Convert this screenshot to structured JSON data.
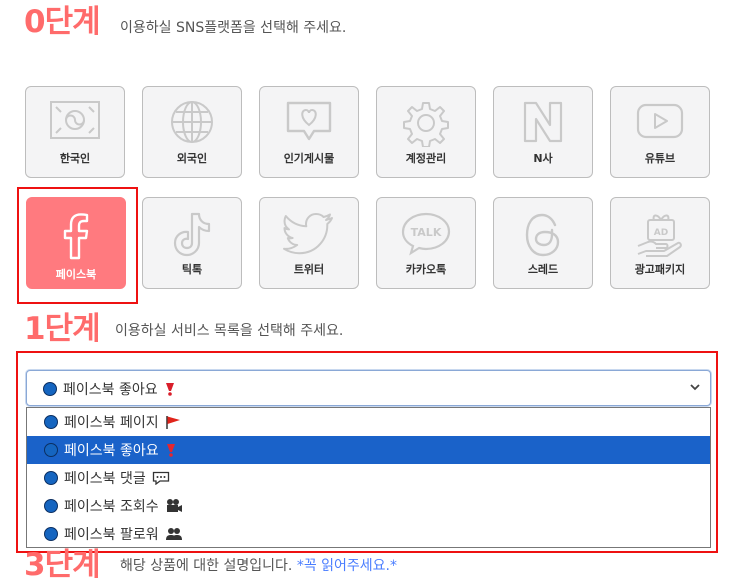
{
  "step0": {
    "title": "0단계",
    "desc": "이용하실 SNS플랫폼을 선택해 주세요."
  },
  "platforms": [
    {
      "label": "한국인",
      "icon": "korean-flag-icon"
    },
    {
      "label": "외국인",
      "icon": "globe-icon"
    },
    {
      "label": "인기게시물",
      "icon": "heart-speech-icon"
    },
    {
      "label": "계정관리",
      "icon": "gear-icon"
    },
    {
      "label": "N사",
      "icon": "naver-n-icon"
    },
    {
      "label": "유튜브",
      "icon": "youtube-play-icon"
    },
    {
      "label": "페이스북",
      "icon": "facebook-icon",
      "selected": true
    },
    {
      "label": "틱톡",
      "icon": "tiktok-icon"
    },
    {
      "label": "트위터",
      "icon": "twitter-bird-icon"
    },
    {
      "label": "카카오톡",
      "icon": "kakaotalk-icon"
    },
    {
      "label": "스레드",
      "icon": "threads-icon"
    },
    {
      "label": "광고패키지",
      "icon": "ad-package-icon"
    }
  ],
  "step1": {
    "title": "1단계",
    "desc": "이용하실 서비스 목록을 선택해 주세요."
  },
  "service_select": {
    "value": "페이스북 좋아요",
    "options": [
      {
        "label": "페이스북 페이지",
        "emoji": "red-flag-icon"
      },
      {
        "label": "페이스북 좋아요",
        "emoji": "red-exclamation-icon",
        "selected": true
      },
      {
        "label": "페이스북 댓글",
        "emoji": "speech-bubble-icon"
      },
      {
        "label": "페이스북 조회수",
        "emoji": "movie-camera-icon"
      },
      {
        "label": "페이스북 팔로워",
        "emoji": "people-silhouette-icon"
      }
    ]
  },
  "step3": {
    "title": "3단계",
    "desc": "해당 상품에 대한 설명입니다.",
    "accent": "*꼭 읽어주세요.*"
  },
  "colors": {
    "accent": "#ff6b6b",
    "tile_active": "#ff7a7f",
    "select_highlight": "#1a62c9",
    "focus_outline": "#ee1111"
  }
}
